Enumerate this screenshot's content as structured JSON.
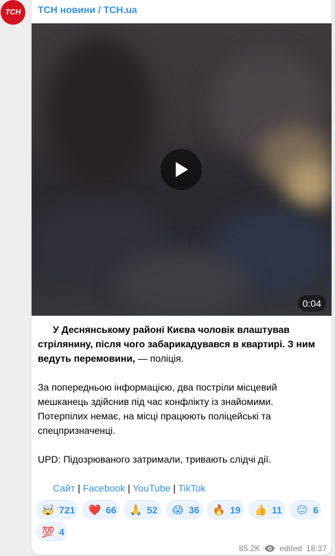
{
  "channel": {
    "avatar_text": "ТСН",
    "name": "ТСН новини / ТСН.ua"
  },
  "video": {
    "duration": "0:04"
  },
  "post": {
    "bold_text": "У Деснянському районі Києва чоловік влаштував стрілянину, після чого забарикадувався в квартирі. З ним ведуть перемовини,",
    "bold_suffix": " — поліція.",
    "paragraph2": "За попередньою інформацією, два постріли місцевий мешканець здійснив під час конфлікту із знайомими. Потерпілих немає, на місці працюють поліцейські та спецпризначенці.",
    "paragraph3": "UPD: Підозрюваного затримали, тривають слідчі дії.",
    "links": [
      "Сайт",
      "Facebook",
      "YouTube",
      "TikTok"
    ],
    "link_separator": "|"
  },
  "reactions": [
    {
      "emoji": "🤯",
      "count": "721"
    },
    {
      "emoji": "❤️",
      "count": "66"
    },
    {
      "emoji": "🙏",
      "count": "52"
    },
    {
      "emoji": "😱",
      "count": "36"
    },
    {
      "emoji": "🔥",
      "count": "19"
    },
    {
      "emoji": "👍",
      "count": "11"
    },
    {
      "emoji": "😐",
      "count": "6"
    },
    {
      "emoji": "💯",
      "count": "4"
    }
  ],
  "footer": {
    "views": "85.2K",
    "edited_label": "edited",
    "time": "18:37"
  },
  "colors": {
    "accent": "#3390ec",
    "brand_red": "#d5121f",
    "reaction_bg": "#eaf3fc"
  }
}
